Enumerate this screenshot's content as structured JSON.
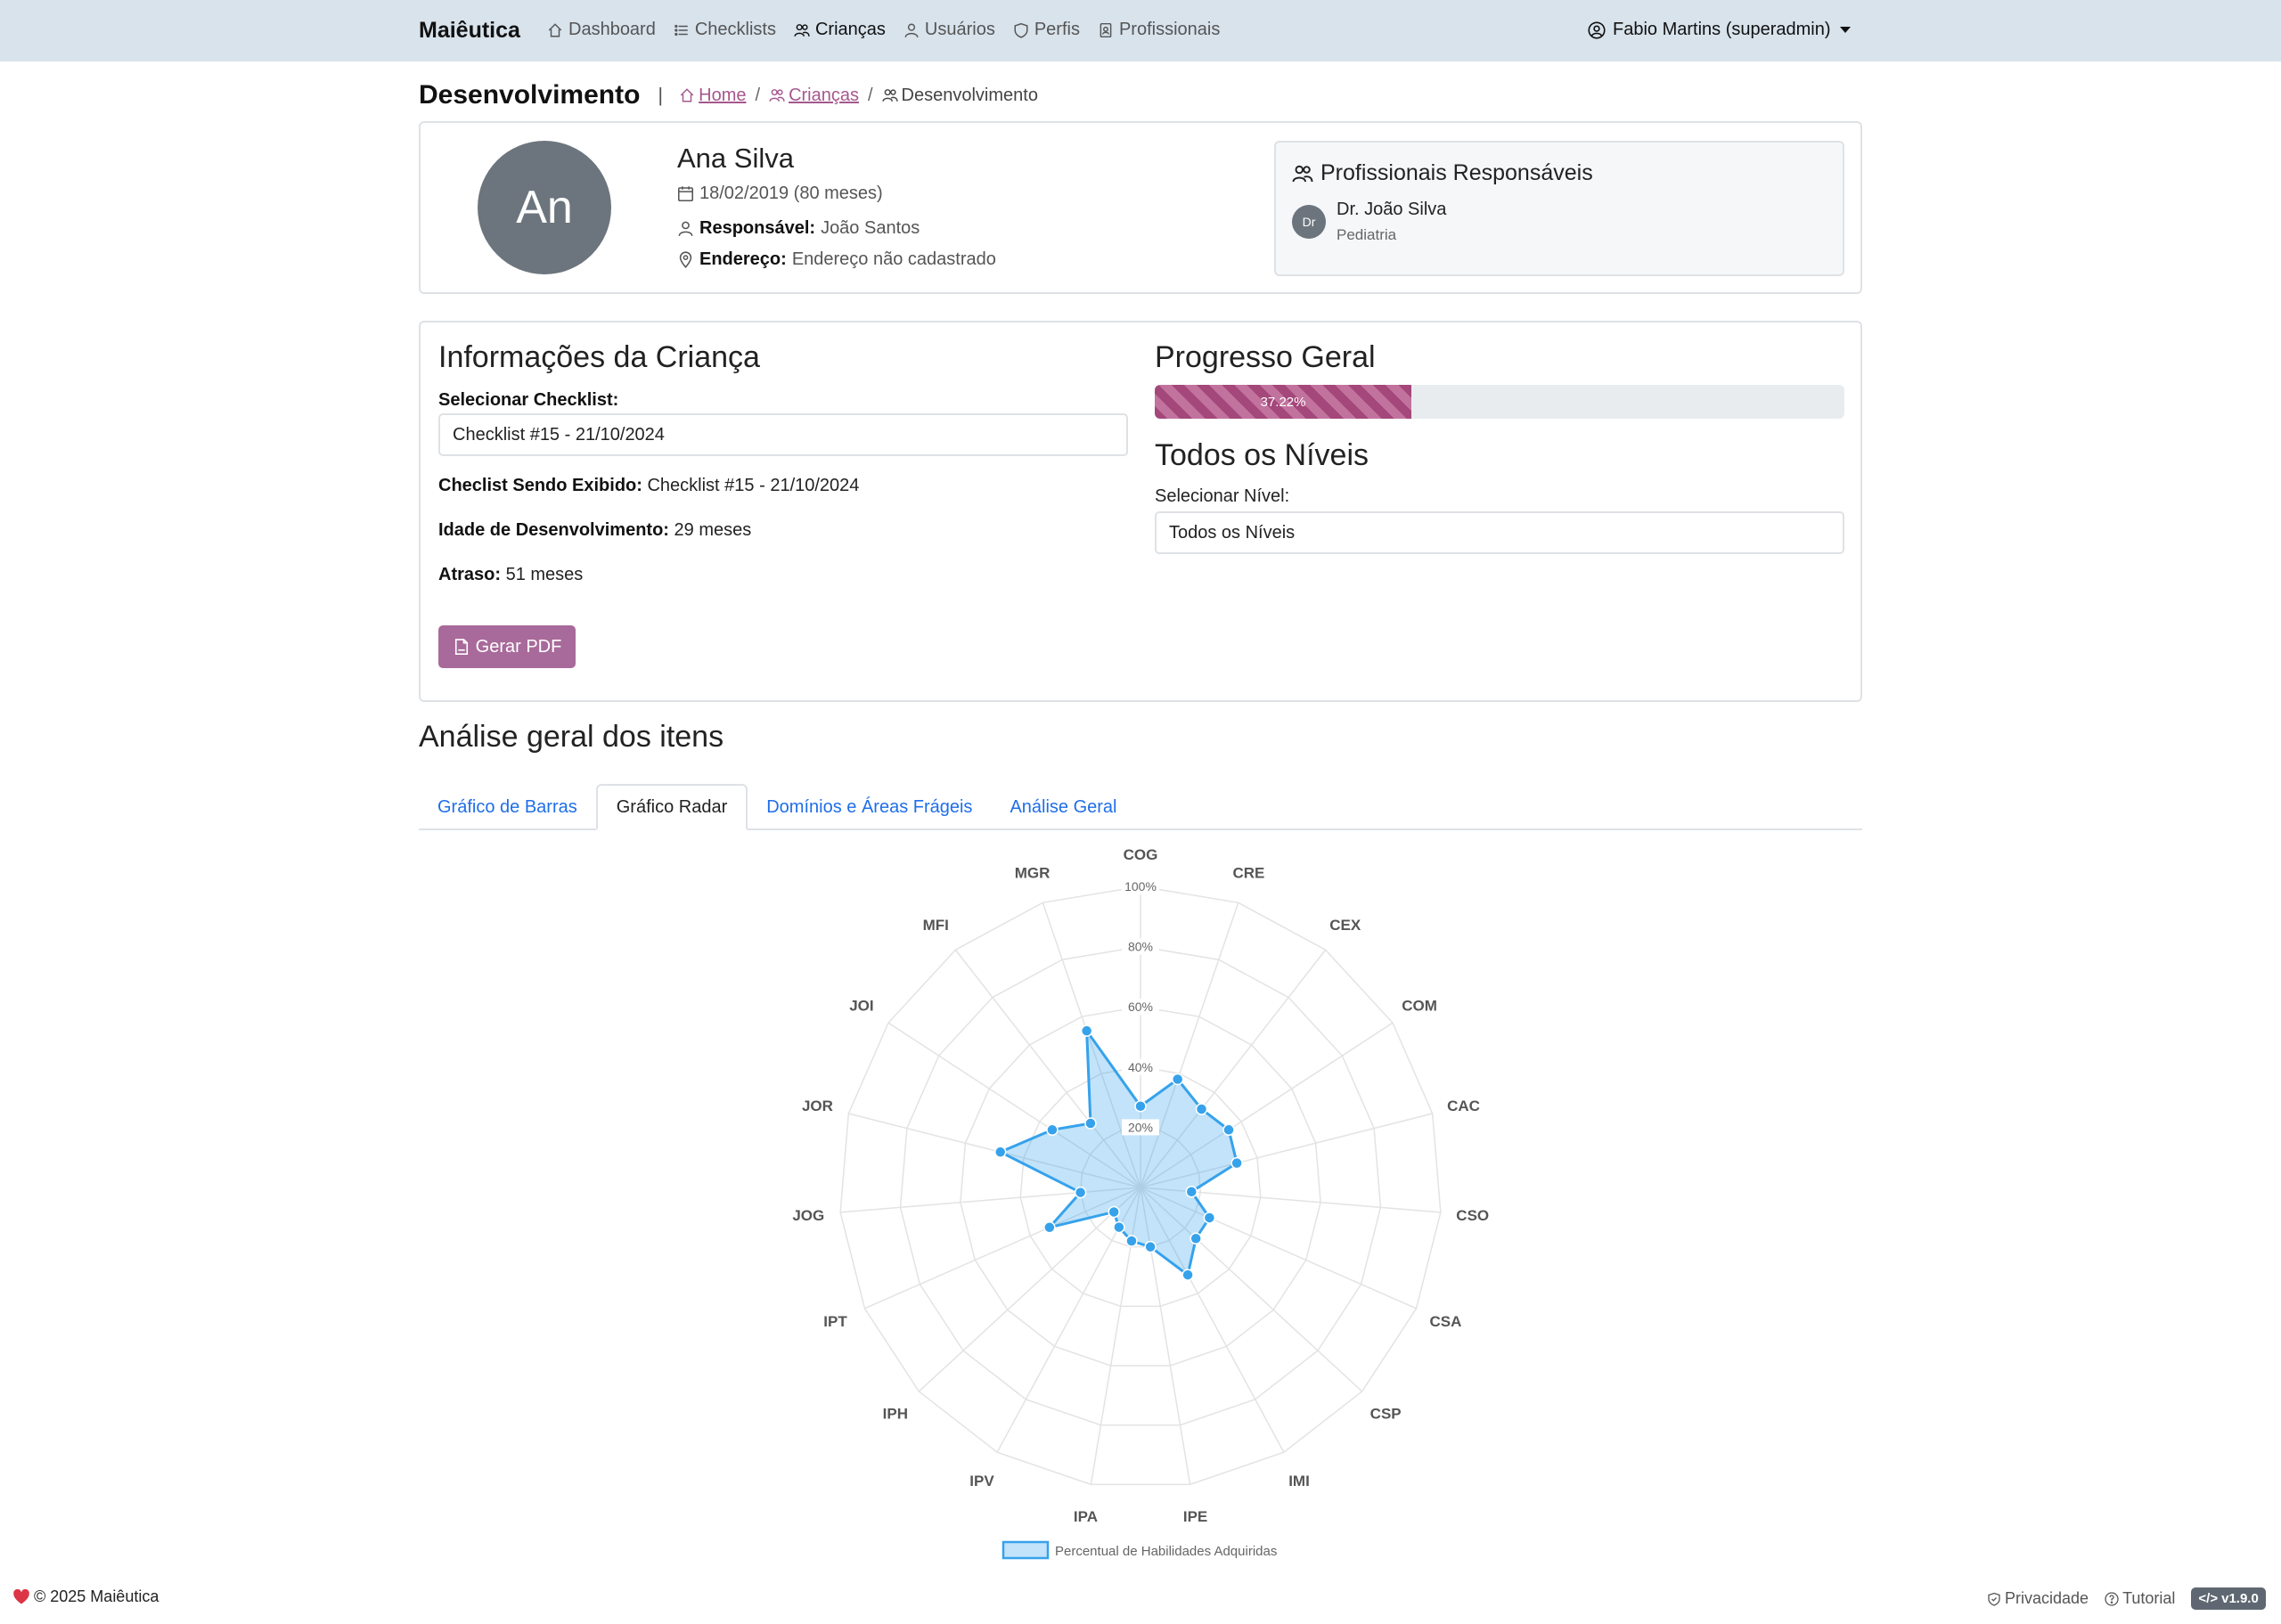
{
  "navbar": {
    "brand": "Maiêutica",
    "links": [
      {
        "label": "Dashboard",
        "icon": "home-icon"
      },
      {
        "label": "Checklists",
        "icon": "list-icon"
      },
      {
        "label": "Crianças",
        "icon": "people-icon",
        "active": true
      },
      {
        "label": "Usuários",
        "icon": "person-icon"
      },
      {
        "label": "Perfis",
        "icon": "shield-icon"
      },
      {
        "label": "Profissionais",
        "icon": "badge-icon"
      }
    ],
    "user": "Fabio Martins (superadmin)"
  },
  "header": {
    "title": "Desenvolvimento",
    "separator": "|",
    "breadcrumb": [
      "Home",
      "Crianças",
      "Desenvolvimento"
    ]
  },
  "profile": {
    "initials": "An",
    "name": "Ana Silva",
    "birth": "18/02/2019 (80 meses)",
    "responsavel_label": "Responsável:",
    "responsavel": "João Santos",
    "endereco_label": "Endereço:",
    "endereco": "Endereço não cadastrado",
    "professionals_title": "Profissionais Responsáveis",
    "professional": {
      "initials": "Dr",
      "name": "Dr. João Silva",
      "specialty": "Pediatria"
    }
  },
  "info": {
    "title": "Informações da Criança",
    "select_label": "Selecionar Checklist:",
    "selected_checklist": "Checklist #15 - 21/10/2024",
    "showing_label": "Checlist Sendo Exibido:",
    "showing_value": "Checklist #15 - 21/10/2024",
    "dev_age_label": "Idade de Desenvolvimento:",
    "dev_age_value": "29 meses",
    "delay_label": "Atraso:",
    "delay_value": "51 meses",
    "pdf_button": "Gerar PDF"
  },
  "progress": {
    "title": "Progresso Geral",
    "percent": 37.22,
    "label": "37.22%"
  },
  "levels": {
    "title": "Todos os Níveis",
    "select_label": "Selecionar Nível:",
    "selected": "Todos os Níveis"
  },
  "analysis": {
    "title": "Análise geral dos itens",
    "tabs": [
      "Gráfico de Barras",
      "Gráfico Radar",
      "Domínios e Áreas Frágeis",
      "Análise Geral"
    ],
    "active_tab": 1
  },
  "chart_data": {
    "type": "radar",
    "categories": [
      "COG",
      "CRE",
      "CEX",
      "COM",
      "CAC",
      "CSO",
      "CSA",
      "CSP",
      "IMI",
      "IPE",
      "IPA",
      "IPV",
      "IPH",
      "IPT",
      "JOG",
      "JOR",
      "JOI",
      "MFI",
      "MGR"
    ],
    "series": [
      {
        "name": "Percentual de Habilidades Adquiridas",
        "values": [
          27,
          38,
          33,
          35,
          33,
          17,
          25,
          25,
          33,
          20,
          18,
          15,
          12,
          33,
          20,
          48,
          35,
          27,
          55
        ]
      }
    ],
    "rlim": [
      0,
      100
    ],
    "ticks": [
      "20%",
      "40%",
      "60%",
      "80%",
      "100%"
    ],
    "legend": "bottom",
    "color": "#36a2eb"
  },
  "footer": {
    "copyright": "© 2025 Maiêutica",
    "privacy": "Privacidade",
    "tutorial": "Tutorial",
    "version": "v1.9.0"
  }
}
